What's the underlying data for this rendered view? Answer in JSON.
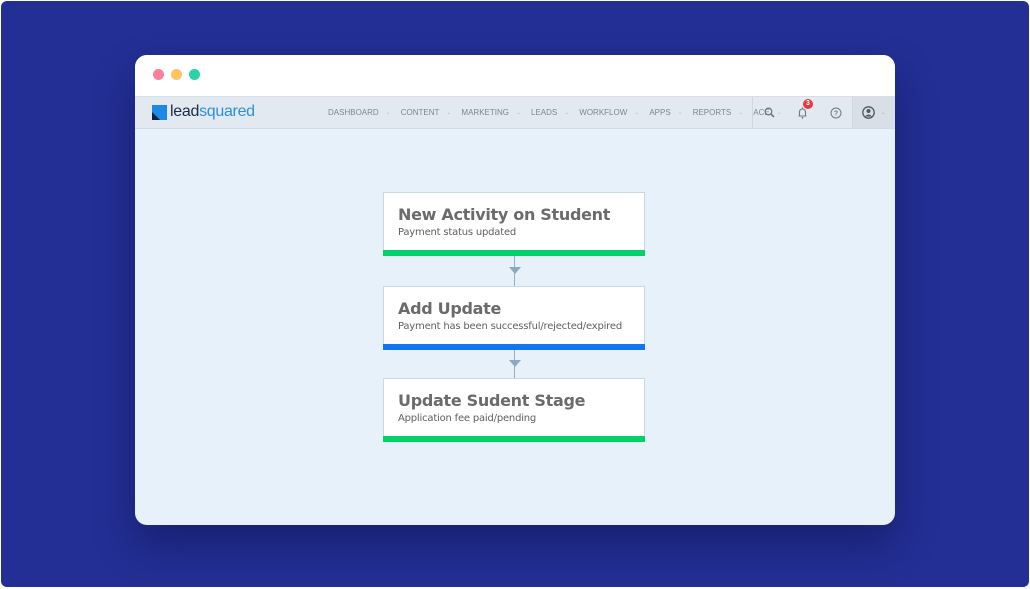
{
  "window": {
    "controls": [
      "close",
      "minimize",
      "maximize"
    ]
  },
  "navbar": {
    "logo": {
      "part1": "lead",
      "part2": "squared"
    },
    "menu": [
      {
        "label": "DASHBOARD"
      },
      {
        "label": "CONTENT"
      },
      {
        "label": "MARKETING"
      },
      {
        "label": "LEADS"
      },
      {
        "label": "WORKFLOW"
      },
      {
        "label": "APPS"
      },
      {
        "label": "REPORTS"
      },
      {
        "label": "ACE"
      }
    ],
    "chevron": "⌄",
    "icons": {
      "search": "search-icon",
      "notifications": "bell-icon",
      "notification_count": "3",
      "help": "help-icon",
      "user": "user-avatar-icon"
    }
  },
  "workflow": {
    "steps": [
      {
        "title": "New Activity on Student",
        "subtitle": "Payment status updated",
        "color": "#00d26a"
      },
      {
        "title": "Add Update",
        "subtitle": "Payment has been successful/rejected/expired",
        "color": "#1275ef"
      },
      {
        "title": "Update Sudent Stage",
        "subtitle": "Application fee paid/pending",
        "color": "#00d26a"
      }
    ]
  },
  "colors": {
    "backdrop": "#232f94",
    "canvas": "#e6f1f9",
    "connector": "#94aec4"
  }
}
